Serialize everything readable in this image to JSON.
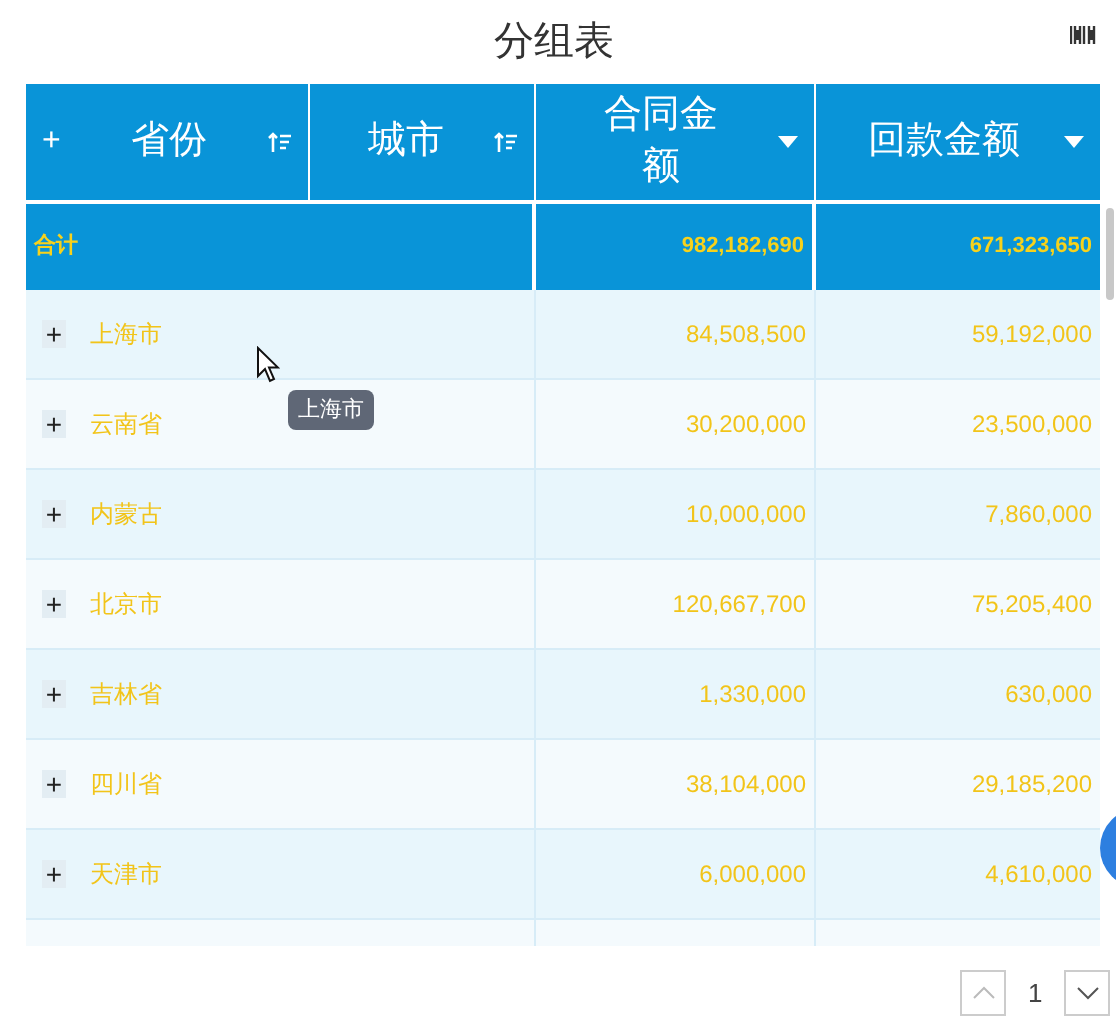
{
  "title": "分组表",
  "header": {
    "expand": "+",
    "columns": [
      {
        "label": "省份",
        "kind": "sort"
      },
      {
        "label": "城市",
        "kind": "sort"
      },
      {
        "label": "合同金额",
        "kind": "dropdown"
      },
      {
        "label": "回款金额",
        "kind": "dropdown"
      }
    ]
  },
  "total": {
    "label": "合计",
    "contract": "982,182,690",
    "payment": "671,323,650"
  },
  "rows": [
    {
      "expand": "+",
      "province": "上海市",
      "contract": "84,508,500",
      "payment": "59,192,000"
    },
    {
      "expand": "+",
      "province": "云南省",
      "contract": "30,200,000",
      "payment": "23,500,000"
    },
    {
      "expand": "+",
      "province": "内蒙古",
      "contract": "10,000,000",
      "payment": "7,860,000"
    },
    {
      "expand": "+",
      "province": "北京市",
      "contract": "120,667,700",
      "payment": "75,205,400"
    },
    {
      "expand": "+",
      "province": "吉林省",
      "contract": "1,330,000",
      "payment": "630,000"
    },
    {
      "expand": "+",
      "province": "四川省",
      "contract": "38,104,000",
      "payment": "29,185,200"
    },
    {
      "expand": "+",
      "province": "天津市",
      "contract": "6,000,000",
      "payment": "4,610,000"
    }
  ],
  "tooltip": "上海市",
  "pager": {
    "page": "1"
  }
}
